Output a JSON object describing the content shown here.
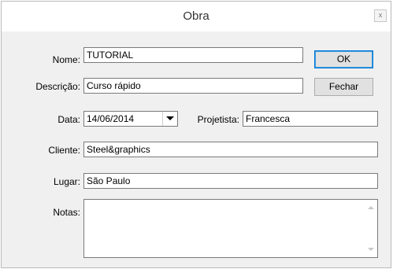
{
  "window": {
    "title": "Obra",
    "close_label": "x"
  },
  "form": {
    "nome": {
      "label": "Nome:",
      "value": "TUTORIAL"
    },
    "descricao": {
      "label": "Descrição:",
      "value": "Curso rápido"
    },
    "data": {
      "label": "Data:",
      "value": "14/06/2014"
    },
    "projetista": {
      "label": "Projetista:",
      "value": "Francesca"
    },
    "cliente": {
      "label": "Cliente:",
      "value": "Steel&graphics"
    },
    "lugar": {
      "label": "Lugar:",
      "value": "São Paulo"
    },
    "notas": {
      "label": "Notas:",
      "value": ""
    }
  },
  "buttons": {
    "ok": "OK",
    "fechar": "Fechar"
  }
}
